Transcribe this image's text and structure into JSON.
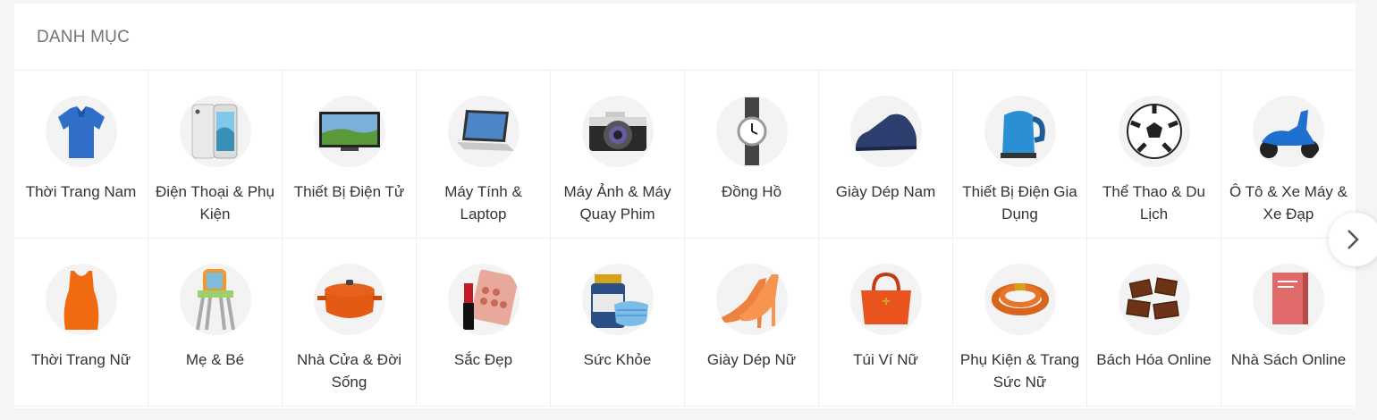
{
  "section": {
    "title": "DANH MỤC"
  },
  "categories": [
    {
      "label": "Thời Trang Nam",
      "icon": "polo-shirt-icon"
    },
    {
      "label": "Điện Thoại & Phụ Kiện",
      "icon": "smartphone-icon"
    },
    {
      "label": "Thiết Bị Điện Tử",
      "icon": "television-icon"
    },
    {
      "label": "Máy Tính & Laptop",
      "icon": "laptop-icon"
    },
    {
      "label": "Máy Ảnh & Máy Quay Phim",
      "icon": "camera-icon"
    },
    {
      "label": "Đồng Hồ",
      "icon": "watch-icon"
    },
    {
      "label": "Giày Dép Nam",
      "icon": "men-shoe-icon"
    },
    {
      "label": "Thiết Bị Điện Gia Dụng",
      "icon": "kettle-icon"
    },
    {
      "label": "Thể Thao & Du Lịch",
      "icon": "soccer-ball-icon"
    },
    {
      "label": "Ô Tô & Xe Máy & Xe Đạp",
      "icon": "scooter-icon"
    },
    {
      "label": "Thời Trang Nữ",
      "icon": "women-top-icon"
    },
    {
      "label": "Mẹ & Bé",
      "icon": "baby-chair-icon"
    },
    {
      "label": "Nhà Cửa & Đời Sống",
      "icon": "cooking-pot-icon"
    },
    {
      "label": "Sắc Đẹp",
      "icon": "makeup-icon"
    },
    {
      "label": "Sức Khỏe",
      "icon": "vitamin-mask-icon"
    },
    {
      "label": "Giày Dép Nữ",
      "icon": "high-heels-icon"
    },
    {
      "label": "Túi Ví Nữ",
      "icon": "handbag-icon"
    },
    {
      "label": "Phụ Kiện & Trang Sức Nữ",
      "icon": "bracelet-icon"
    },
    {
      "label": "Bách Hóa Online",
      "icon": "chocolate-icon"
    },
    {
      "label": "Nhà Sách Online",
      "icon": "book-icon"
    }
  ],
  "navigation": {
    "next_icon": "chevron-right-icon"
  }
}
